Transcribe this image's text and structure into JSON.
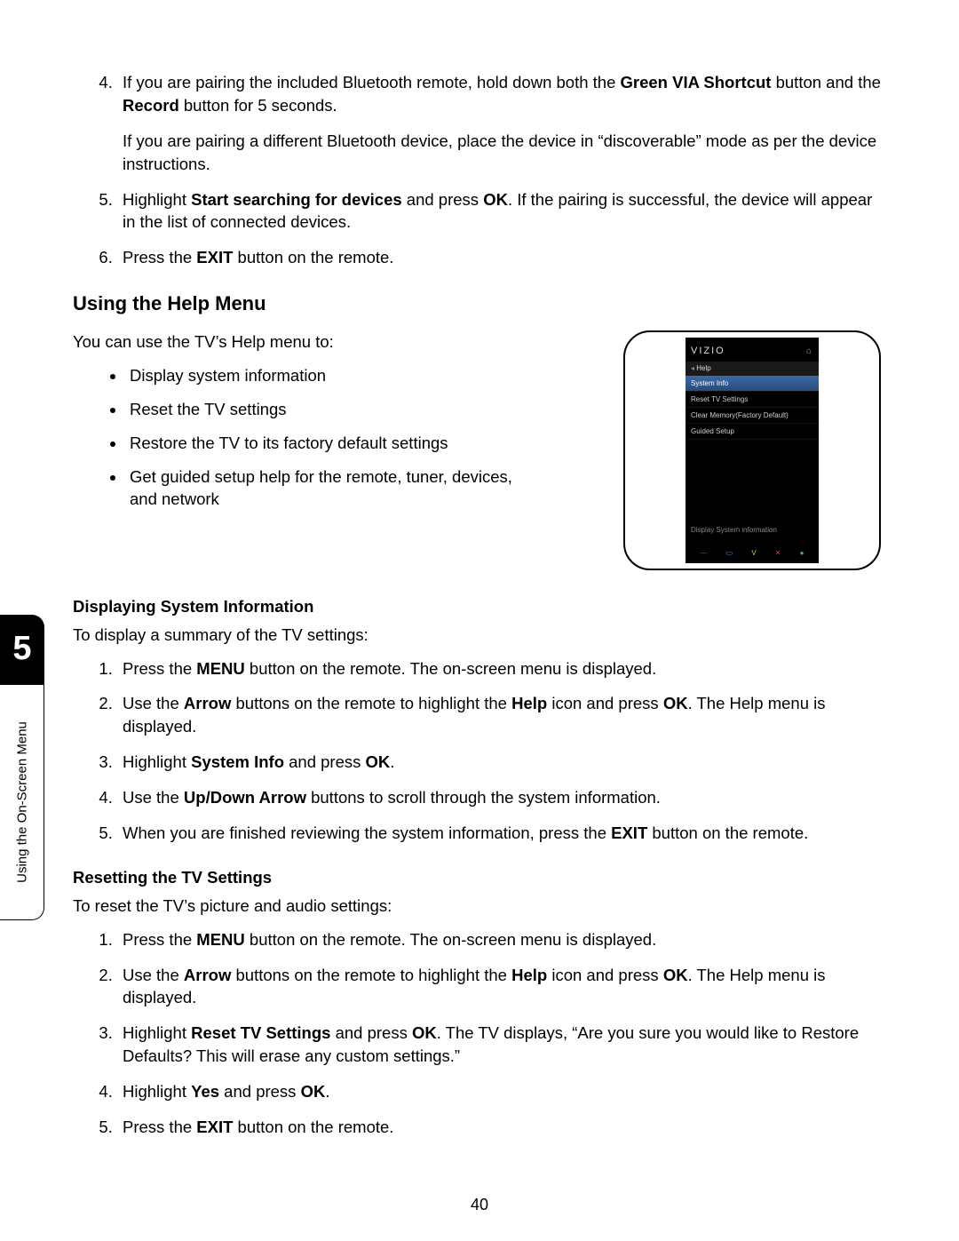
{
  "sidebar": {
    "chapter": "5",
    "label": "Using the On-Screen Menu"
  },
  "top_list": {
    "item4": {
      "line1_a": "If you are pairing the included Bluetooth remote, hold down both the ",
      "line1_b_bold": "Green VIA Shortcut",
      "line1_c": " button and the ",
      "line1_d_bold": "Record",
      "line1_e": " button for 5 seconds.",
      "para2": "If you are pairing a different Bluetooth device, place the device in “discoverable” mode as per the device instructions."
    },
    "item5": {
      "a": "Highlight ",
      "b_bold": "Start searching for devices",
      "c": " and press ",
      "d_bold": "OK",
      "e": ". If the pairing is successful, the device will appear in the list of connected devices."
    },
    "item6": {
      "a": "Press the ",
      "b_bold": "EXIT",
      "c": " button on the remote."
    }
  },
  "heading_help": "Using the Help Menu",
  "help_intro": "You can use the TV’s Help menu to:",
  "help_bullets": [
    "Display system information",
    "Reset the TV settings",
    "Restore the TV to its factory default settings",
    "Get guided setup help for the remote, tuner, devices, and network"
  ],
  "figure": {
    "brand": "VIZIO",
    "crumb": "Help",
    "rows": [
      {
        "label": "System Info",
        "selected": true
      },
      {
        "label": "Reset TV Settings",
        "selected": false
      },
      {
        "label": "Clear Memory(Factory Default)",
        "selected": false
      },
      {
        "label": "Guided Setup",
        "selected": false
      }
    ],
    "hint": "Display System information"
  },
  "sub1_head": "Displaying System Information",
  "sub1_intro": "To display a summary of the TV settings:",
  "sub1_steps": {
    "s1": {
      "a": "Press the ",
      "b_bold": "MENU",
      "c": " button on the remote. The on-screen menu is displayed."
    },
    "s2": {
      "a": "Use the ",
      "b_bold": "Arrow",
      "c": " buttons on the remote to highlight the ",
      "d_bold": "Help",
      "e": " icon and press ",
      "f_bold": "OK",
      "g": ". The Help menu is displayed."
    },
    "s3": {
      "a": "Highlight ",
      "b_bold": "System Info",
      "c": " and press ",
      "d_bold": "OK",
      "e": "."
    },
    "s4": {
      "a": "Use the ",
      "b_bold": "Up/Down Arrow",
      "c": " buttons to scroll through the system information."
    },
    "s5": {
      "a": "When you are finished reviewing the system information, press the ",
      "b_bold": "EXIT",
      "c": " button on the remote."
    }
  },
  "sub2_head": "Resetting the TV Settings",
  "sub2_intro": "To reset the TV’s picture and audio settings:",
  "sub2_steps": {
    "s1": {
      "a": "Press the ",
      "b_bold": "MENU",
      "c": " button on the remote. The on-screen menu is displayed."
    },
    "s2": {
      "a": "Use the ",
      "b_bold": "Arrow",
      "c": " buttons on the remote to highlight the ",
      "d_bold": "Help",
      "e": " icon and press ",
      "f_bold": "OK",
      "g": ". The Help menu is displayed."
    },
    "s3": {
      "a": "Highlight ",
      "b_bold": "Reset TV Settings",
      "c": " and press ",
      "d_bold": "OK",
      "e": ". The TV displays, “Are you sure you would like to Restore Defaults? This will erase any custom settings.”"
    },
    "s4": {
      "a": "Highlight ",
      "b_bold": "Yes",
      "c": " and press ",
      "d_bold": "OK",
      "e": "."
    },
    "s5": {
      "a": "Press the ",
      "b_bold": "EXIT",
      "c": " button on the remote."
    }
  },
  "page_number": "40"
}
